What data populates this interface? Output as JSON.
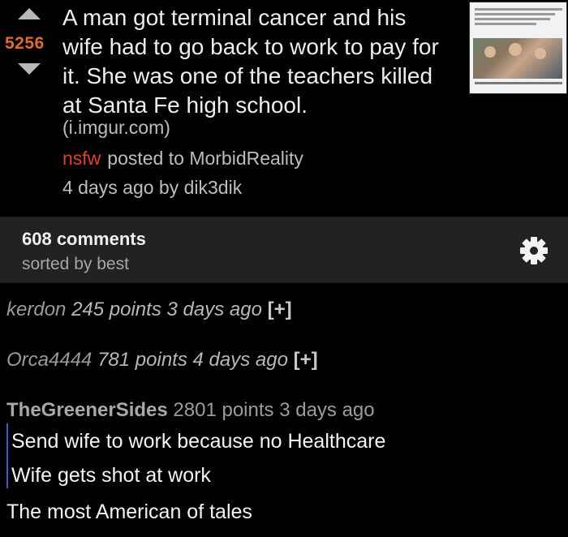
{
  "post": {
    "score": "5256",
    "title": "A man got terminal cancer and his wife had to go back to work to pay for it. She was one of the teachers killed at Santa Fe high school.",
    "domain": "(i.imgur.com)",
    "nsfw": "nsfw",
    "posted_to": "posted to MorbidReality",
    "time_by": "4 days ago by dik3dik"
  },
  "comments_bar": {
    "count": "608 comments",
    "sorted": "sorted by best",
    "settings_icon": "gear-icon"
  },
  "comments": [
    {
      "user": "kerdon",
      "points": "245 points",
      "time": "3 days ago",
      "expand": "[+]"
    },
    {
      "user": "Orca4444",
      "points": "781 points",
      "time": "4 days ago",
      "expand": "[+]"
    }
  ],
  "top_comment": {
    "user": "TheGreenerSides",
    "points": "2801 points",
    "time": "3 days ago",
    "quote_lines": [
      "Send wife to work because no Healthcare",
      "Wife gets shot at work"
    ],
    "body": "The most American of tales"
  },
  "colors": {
    "score": "#e06b33",
    "nsfw": "#e0402f",
    "quote_bar": "#4a58b8",
    "bar_bg": "#222224"
  }
}
